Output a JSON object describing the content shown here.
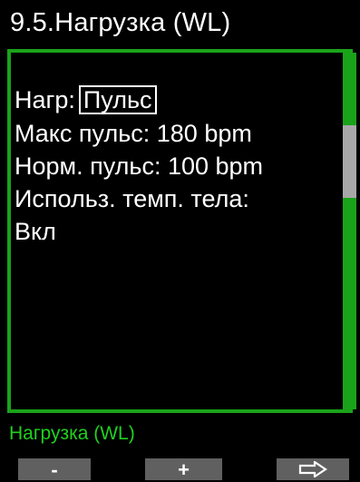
{
  "header": {
    "title": "9.5.Нагрузка (WL)"
  },
  "menu": {
    "rows": [
      {
        "label": "Нагр:",
        "value": "Пульс"
      },
      {
        "text": "Макс пульс: 180 bpm"
      },
      {
        "text": "Норм. пульс: 100 bpm"
      },
      {
        "text": "Использ. темп. тела:"
      },
      {
        "text": "Вкл"
      }
    ]
  },
  "status": {
    "text": "Нагрузка (WL)"
  },
  "softkeys": {
    "minus": "-",
    "plus": "+",
    "next_icon": "right-arrow-outline-icon"
  },
  "colors": {
    "background": "#000000",
    "frame": "#1aa31a",
    "status_text": "#1fd11f",
    "scroll_thumb": "#a8a8a8",
    "softkey": "#606060",
    "text": "#ffffff"
  }
}
